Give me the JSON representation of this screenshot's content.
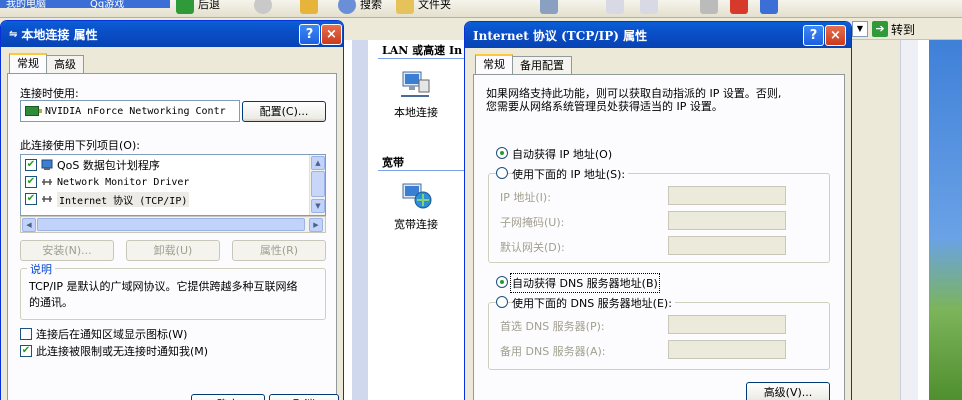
{
  "toolbar": {
    "tab_left_1": "我的电脑",
    "tab_left_2": "Qq游戏",
    "back_label": "后退",
    "search_label": "搜索",
    "folders_label": "文件夹"
  },
  "address_bar": {
    "go_label": "转到"
  },
  "explorer": {
    "lan_header": "LAN 或高速 In",
    "local_connection_label": "本地连接",
    "broadband_header": "宽带",
    "broadband_connection_label": "宽带连接"
  },
  "local_conn_dialog": {
    "title": "本地连接 属性",
    "tabs": [
      "常规",
      "高级"
    ],
    "connect_using_label": "连接时使用:",
    "device_name": "NVIDIA nForce Networking Contr",
    "configure_button": "配置(C)...",
    "items_label": "此连接使用下列项目(O):",
    "items": [
      {
        "label": "QoS 数据包计划程序",
        "checked": true,
        "icon": "qos-icon"
      },
      {
        "label": "Network Monitor Driver",
        "checked": true,
        "icon": "network-protocol-icon"
      },
      {
        "label": "Internet 协议 (TCP/IP)",
        "checked": true,
        "icon": "network-protocol-icon"
      }
    ],
    "install_button": "安装(N)...",
    "uninstall_button": "卸载(U)",
    "properties_button": "属性(R)",
    "description_title": "说明",
    "description_text_1": "TCP/IP 是默认的广域网协议。它提供跨越多种互联网络",
    "description_text_2": "的通讯。",
    "show_icon_label": "连接后在通知区域显示图标(W)",
    "show_icon_checked": false,
    "notify_label": "此连接被限制或无连接时通知我(M)",
    "notify_checked": true,
    "ok_button": "确定",
    "cancel_button": "取消"
  },
  "tcpip_dialog": {
    "title": "Internet 协议 (TCP/IP) 属性",
    "tabs": [
      "常规",
      "备用配置"
    ],
    "intro_line_1": "如果网络支持此功能，则可以获取自动指派的 IP 设置。否则,",
    "intro_line_2": "您需要从网络系统管理员处获得适当的 IP 设置。",
    "auto_ip_label": "自动获得 IP 地址(O)",
    "auto_ip_selected": true,
    "manual_ip_label": "使用下面的 IP 地址(S):",
    "ip_address_label": "IP 地址(I):",
    "subnet_mask_label": "子网掩码(U):",
    "default_gateway_label": "默认网关(D):",
    "auto_dns_label": "自动获得 DNS 服务器地址(B)",
    "auto_dns_selected": true,
    "manual_dns_label": "使用下面的 DNS 服务器地址(E):",
    "preferred_dns_label": "首选 DNS 服务器(P):",
    "alternate_dns_label": "备用 DNS 服务器(A):",
    "advanced_button": "高级(V)..."
  },
  "colors": {
    "titlebar": "#0a4fc8",
    "accent_tab": "#ffc83c",
    "check_green": "#21a121",
    "group_title": "#0046d5"
  }
}
